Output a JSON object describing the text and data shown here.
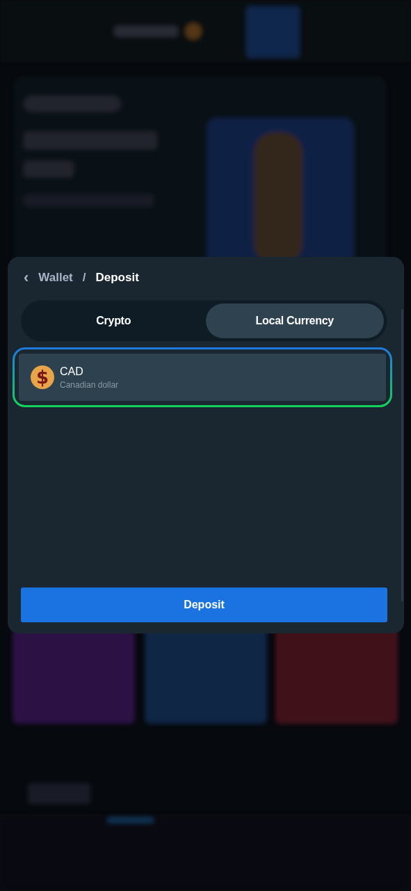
{
  "breadcrumb": {
    "back": "‹",
    "parent": "Wallet",
    "separator": "/",
    "current": "Deposit"
  },
  "tabs": [
    {
      "label": "Crypto",
      "selected": false
    },
    {
      "label": "Local Currency",
      "selected": true
    }
  ],
  "currencies": [
    {
      "symbol": "$",
      "code": "CAD",
      "name": "Canadian dollar",
      "selected": true
    }
  ],
  "deposit_button": "Deposit"
}
